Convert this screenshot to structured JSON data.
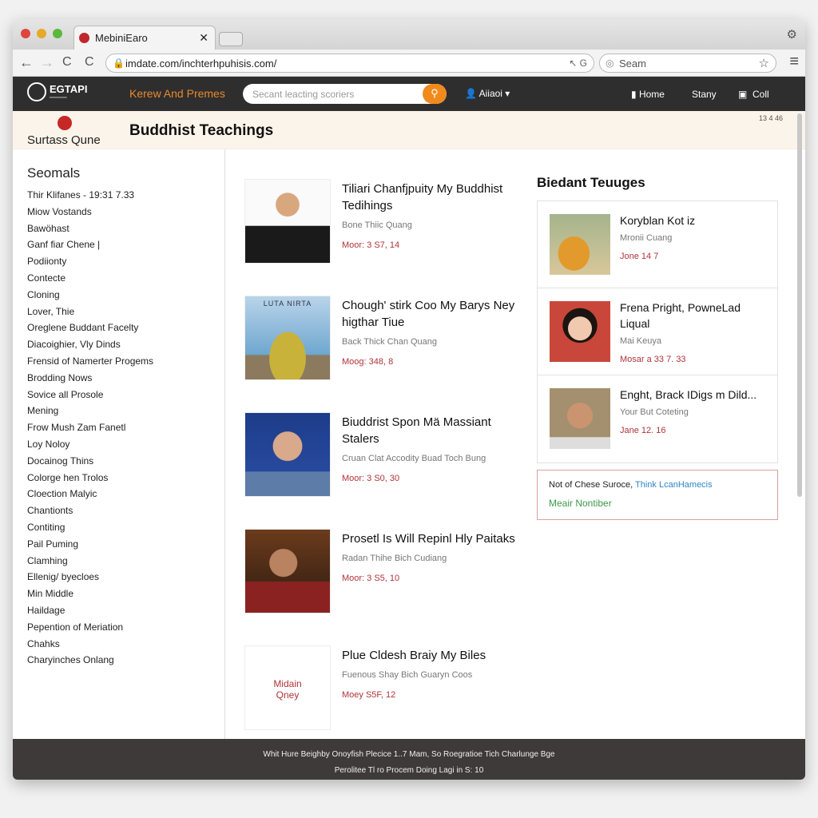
{
  "browser": {
    "tab_title": "MebiniEaro",
    "url": "imdate.com/inchterhpuhisis.com/",
    "search_placeholder": "Seam"
  },
  "nav": {
    "logo": "EGTAPI",
    "brand": "Kerew And Premes",
    "search_placeholder": "Secant leacting scoriers",
    "account": "Aiiaoi ▾",
    "links": [
      "Home",
      "Stany",
      "Coll"
    ]
  },
  "banner": {
    "site_name": "Surtass Qune",
    "title": "Buddhist Teachings",
    "count": "13 4 46"
  },
  "sidebar": {
    "heading": "Seomals",
    "items": [
      "Thir Klifanes - 19:31 7.33",
      "Miow Vostands",
      "Bawöhast",
      "Ganf fiar Chene |",
      "Podiionty",
      "Contecte",
      "Cloning",
      "Lover, Thie",
      "Oreglene Buddant Facelty",
      "Diacoighier, Vly Dinds",
      "Frensid of Namerter Progems",
      "Brodding Nows",
      "Sovice all Prosole",
      "Mening",
      "Frow Mush Zam Fanetl",
      "Loy Noloy",
      "Docainog Thins",
      "Colorge hen Trolos",
      "Cloection Malyic",
      "Chantionts",
      "Contiting",
      "Pail Puming",
      "Clamhing",
      "Ellenig/ byecloes",
      "Min Middle",
      "Haildage",
      "Pepention of Meriation",
      "Chahks",
      "Charyinches Onlang"
    ]
  },
  "main": {
    "items": [
      {
        "title": "Tiliari Chanfjpuity My Buddhist Tedihings",
        "author": "Bone Thiic Quang",
        "price": "Moor: 3 S7, 14",
        "thumb": "person-black-shirt"
      },
      {
        "title": "Chough' stirk Coo My Barys Ney higthar Tiue",
        "author": "Back Thick Chan Quang",
        "price": "Moog: 348, 8",
        "thumb": "buddha-statue",
        "thumb_text": "LUTA NIRTA"
      },
      {
        "title": "Biuddrist Spon Mä Massiant Stalers",
        "author": "Cruan Clat Accodity Buad Toch Bung",
        "price": "Moor: 3 S0, 30",
        "thumb": "man-portrait"
      },
      {
        "title": "Prosetl Is Will Repinl Hly Paitaks",
        "author": "Radan Thihe Bich Cudiang",
        "price": "Moor: 3 S5, 10",
        "thumb": "man-red-shirt"
      },
      {
        "title": "Plue Cldesh Braiy My Biles",
        "author": "Fuenous Shay Bich Guaryn Coos",
        "price": "Moey S5F, 12",
        "thumb": "placeholder",
        "thumb_text": "Midain Qney"
      }
    ]
  },
  "right": {
    "heading": "Biedant Teuuges",
    "cards": [
      {
        "title": "Koryblan Kot iz",
        "author": "Mronii Cuang",
        "date": "Jone 14 7",
        "thumb": "monk-painting"
      },
      {
        "title": "Frena Pright, PowneLad Liqual",
        "author": "Mai Keuya",
        "date": "Mosar a 33 7. 33",
        "thumb": "woman-portrait"
      },
      {
        "title": "Enght, Brack IDigs m Dild...",
        "author": "Your But Coteting",
        "date": "Jane 12. 16",
        "thumb": "man-portrait"
      }
    ],
    "notice": {
      "text": "Not of Chese Suroce,",
      "link": "Think LcanHamecis",
      "more": "Meair Nontiber"
    }
  },
  "footer": {
    "line1": "Whit Hure Beighby Onoyfish Plecice 1..7 Mam, So Roegratioe Tich Charlunge Bge",
    "line2": "Perolitee Tl ro Procem Doing Lagi in S: 10"
  },
  "colors": {
    "accent": "#f08a1c",
    "nav_bg": "#2f2e2e",
    "price": "#b0333a",
    "link": "#2f86c5"
  }
}
